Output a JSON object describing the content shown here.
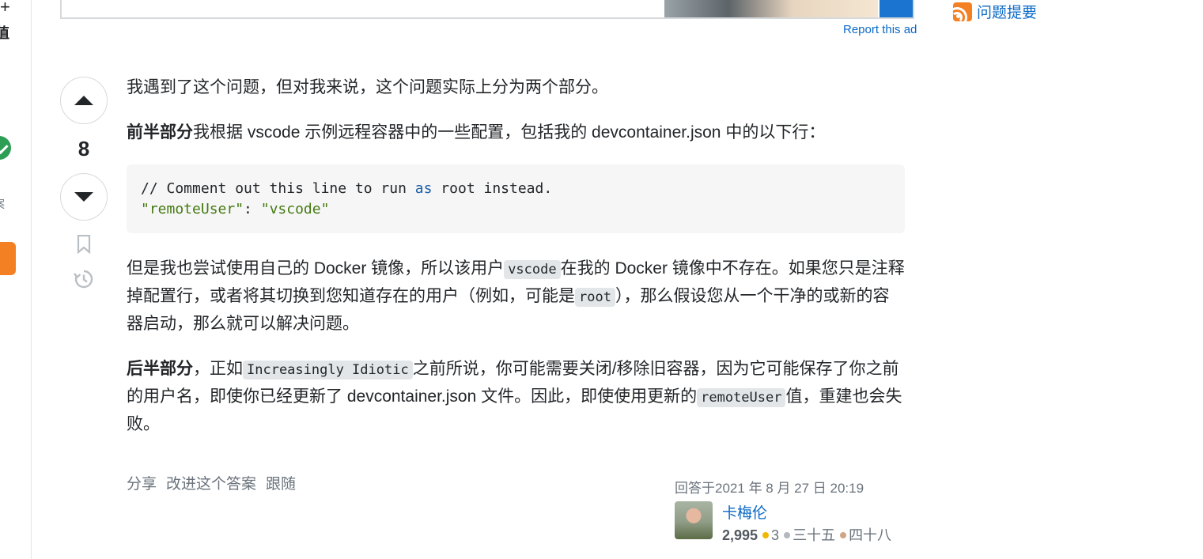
{
  "left_rail": {
    "text_top": "+",
    "text_1": "值",
    "text_2": "案"
  },
  "ad": {
    "report_label": "Report this ad"
  },
  "sidebar": {
    "link_label": "问题提要"
  },
  "vote": {
    "count": "8"
  },
  "answer": {
    "p1": "我遇到了这个问题，但对我来说，这个问题实际上分为两个部分。",
    "p2_bold": "前半部分",
    "p2_text": "我根据 vscode 示例远程容器中的一些配置，包括我的 devcontainer.json 中的以下行：",
    "code_comment_a": "// Comment out this line to run ",
    "code_comment_kw": "as",
    "code_comment_b": " root instead.",
    "code_key": "\"remoteUser\"",
    "code_colon": ": ",
    "code_value": "\"vscode\"",
    "p3_a": "但是我也尝试使用自己的 Docker 镜像，所以该用户",
    "p3_code1": "vscode",
    "p3_b": "在我的 Docker 镜像中不存在。如果您只是注释掉配置行，或者将其切换到您知道存在的用户（例如，可能是",
    "p3_code2": "root",
    "p3_c": "），那么假设您从一个干净的或新的容器启动，那么就可以解决问题。",
    "p4_bold": "后半部分",
    "p4_a": "，正如",
    "p4_code1": "Increasingly Idiotic",
    "p4_b": "之前所说，你可能需要关闭/移除旧容器，因为它可能保存了你之前的用户名，即使你已经更新了 devcontainer.json 文件。因此，即使使用更新的",
    "p4_code2": "remoteUser",
    "p4_c": "值，重建也会失败。"
  },
  "post_menu": {
    "share": "分享",
    "improve": "改进这个答案",
    "follow": "跟随"
  },
  "user_card": {
    "answered": "回答于2021 年 8 月 27 日 20:19",
    "name": "卡梅伦",
    "reputation": "2,995",
    "gold": "3",
    "silver": "三十五",
    "bronze": "四十八"
  },
  "colors": {
    "gold": "#f1b600",
    "silver": "#b4b8bc",
    "bronze": "#d1a684",
    "link": "#0a69c6",
    "accent": "#f48024"
  }
}
